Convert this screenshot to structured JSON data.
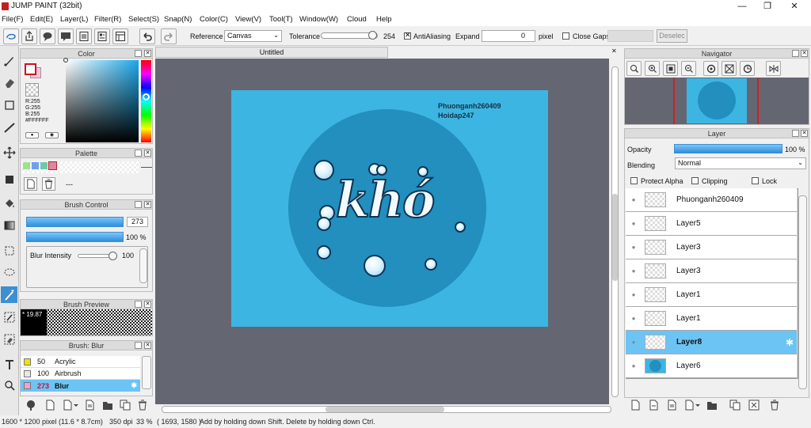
{
  "window": {
    "title": "JUMP PAINT (32bit)",
    "minimize": "—",
    "maximize": "❐",
    "close": "✕"
  },
  "menu": [
    "File(F)",
    "Edit(E)",
    "Layer(L)",
    "Filter(R)",
    "Select(S)",
    "Snap(N)",
    "Color(C)",
    "View(V)",
    "Tool(T)",
    "Window(W)",
    "Cloud",
    "Help"
  ],
  "toolbar": {
    "reference_label": "Reference",
    "reference_value": "Canvas",
    "tolerance_label": "Tolerance",
    "tolerance_value": "254",
    "tolerance_level": 0.99,
    "antialiasing_label": "AntiAliasing",
    "antialiasing_checked": true,
    "expand_label": "Expand",
    "expand_value": "0",
    "expand_unit": "pixel",
    "close_gaps_label": "Close Gaps",
    "deselect_label": "Deselec"
  },
  "color_panel": {
    "title": "Color",
    "r": "R:255",
    "g": "G:255",
    "b": "B:255",
    "hex": "#FFFFFF"
  },
  "palette_panel": {
    "title": "Palette",
    "swatches": [
      "#9ee08e",
      "#6fa0ee",
      "#6ec9a9",
      "#d58aa0"
    ],
    "dash": "---"
  },
  "brush_control": {
    "title": "Brush Control",
    "size": "273",
    "opacity": "100 %",
    "blur_label": "Blur Intensity",
    "blur_value": "100"
  },
  "brush_preview": {
    "title": "Brush Preview",
    "size_label": "* 19.87"
  },
  "brush_list": {
    "title": "Brush: Blur",
    "items": [
      {
        "size": "50",
        "name": "Acrylic",
        "color": "#f2e200"
      },
      {
        "size": "100",
        "name": "Airbrush",
        "color": "#e8e8e8"
      },
      {
        "size": "273",
        "name": "Blur",
        "color": "#f1a2cc"
      }
    ]
  },
  "canvas": {
    "tab": "Untitled",
    "watermark_line1": "Phuonganh260409",
    "watermark_line2": "Hoidap247",
    "art_text": "khó",
    "bg_color": "#3db5e3",
    "circle_color": "#228fbe"
  },
  "navigator": {
    "title": "Navigator"
  },
  "layer_panel": {
    "title": "Layer",
    "opacity_label": "Opacity",
    "opacity_value": "100 %",
    "blending_label": "Blending",
    "blending_value": "Normal",
    "protect_alpha": "Protect Alpha",
    "clipping": "Clipping",
    "lock": "Lock",
    "layers": [
      {
        "name": "Phuonganh260409"
      },
      {
        "name": "Layer5"
      },
      {
        "name": "Layer3"
      },
      {
        "name": "Layer3"
      },
      {
        "name": "Layer1"
      },
      {
        "name": "Layer1"
      },
      {
        "name": "Layer8"
      },
      {
        "name": "Layer6"
      }
    ]
  },
  "status": {
    "size": "1600 * 1200 pixel",
    "cm": "(11.6 * 8.7cm)",
    "dpi": "350 dpi",
    "zoom": "33 %",
    "coords": "( 1693, 1580 )",
    "hint": "Add by holding down Shift. Delete by holding down Ctrl."
  }
}
